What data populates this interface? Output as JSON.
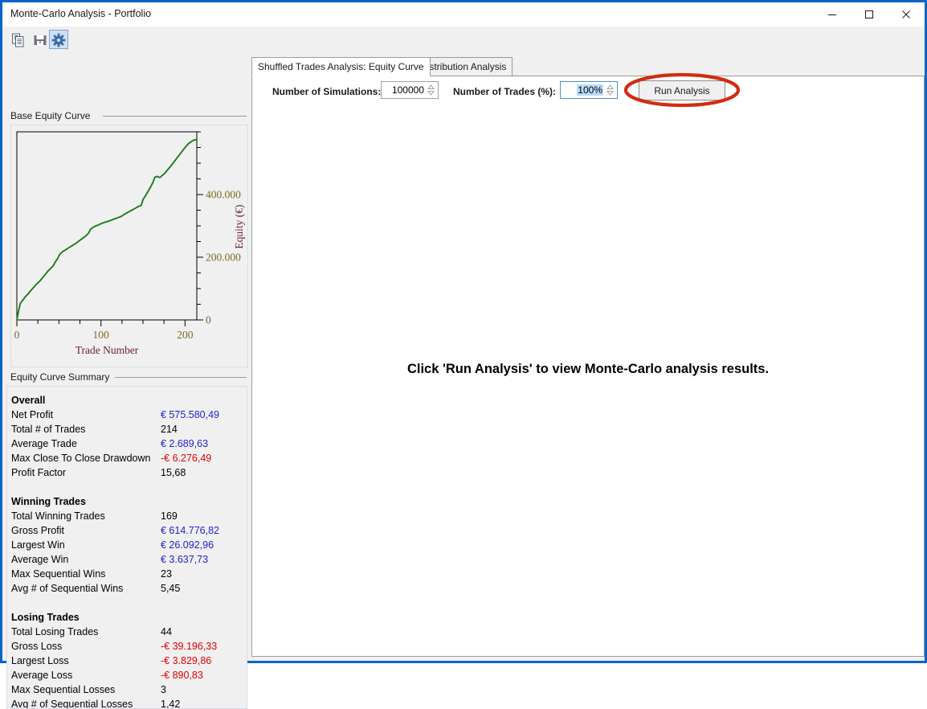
{
  "window": {
    "title": "Monte-Carlo Analysis - Portfolio",
    "minimize_label": "Minimize",
    "maximize_label": "Maximize",
    "close_label": "Close",
    "accent_color": "#0a64c8"
  },
  "toolbar": {
    "buttons": [
      {
        "name": "copy-icon",
        "label": "Copy"
      },
      {
        "name": "save-icon",
        "label": "Save"
      },
      {
        "name": "settings-gear-icon",
        "label": "Settings",
        "selected": true
      }
    ]
  },
  "left_pane": {
    "chart_group_title": "Base Equity Curve",
    "summary_group_title": "Equity Curve Summary",
    "summary": {
      "sections": [
        {
          "title": "Overall",
          "rows": [
            {
              "label": "Net Profit",
              "value": "€ 575.580,49",
              "tone": "pos"
            },
            {
              "label": "Total # of Trades",
              "value": "214",
              "tone": "neutral"
            },
            {
              "label": "Average Trade",
              "value": "€ 2.689,63",
              "tone": "pos"
            },
            {
              "label": "Max Close To Close Drawdown",
              "value": "-€ 6.276,49",
              "tone": "neg"
            },
            {
              "label": "Profit Factor",
              "value": "15,68",
              "tone": "neutral"
            }
          ]
        },
        {
          "title": "Winning Trades",
          "rows": [
            {
              "label": "Total Winning Trades",
              "value": "169",
              "tone": "neutral"
            },
            {
              "label": "Gross Profit",
              "value": "€ 614.776,82",
              "tone": "pos"
            },
            {
              "label": "Largest Win",
              "value": "€ 26.092,96",
              "tone": "pos"
            },
            {
              "label": "Average Win",
              "value": "€ 3.637,73",
              "tone": "pos"
            },
            {
              "label": "Max Sequential Wins",
              "value": "23",
              "tone": "neutral"
            },
            {
              "label": "Avg # of Sequential Wins",
              "value": "5,45",
              "tone": "neutral"
            }
          ]
        },
        {
          "title": "Losing Trades",
          "rows": [
            {
              "label": "Total Losing Trades",
              "value": "44",
              "tone": "neutral"
            },
            {
              "label": "Gross Loss",
              "value": "-€ 39.196,33",
              "tone": "neg"
            },
            {
              "label": "Largest Loss",
              "value": "-€ 3.829,86",
              "tone": "neg"
            },
            {
              "label": "Average Loss",
              "value": "-€ 890,83",
              "tone": "neg"
            },
            {
              "label": "Max Sequential Losses",
              "value": "3",
              "tone": "neutral"
            },
            {
              "label": "Avg # of Sequential Losses",
              "value": "1,42",
              "tone": "neutral"
            }
          ]
        }
      ]
    }
  },
  "tabs": [
    {
      "label": "Shuffled Trades Analysis: Equity Curve",
      "active": true
    },
    {
      "label": "Distribution Analysis",
      "active": false
    }
  ],
  "controls": {
    "simulations_label": "Number of Simulations:",
    "simulations_value": "100000",
    "trades_label": "Number of Trades (%):",
    "trades_value": "100%",
    "trades_value_selected": true,
    "run_button_label": "Run Analysis",
    "annotation_color": "#d42b10"
  },
  "main": {
    "placeholder_message": "Click 'Run Analysis' to view Monte-Carlo analysis results."
  },
  "chart_data": {
    "type": "line",
    "title": "Base Equity Curve",
    "xlabel": "Trade Number",
    "ylabel": "Equity (€)",
    "xlim": [
      0,
      214
    ],
    "ylim": [
      0,
      600000
    ],
    "xticks": [
      0,
      100,
      200
    ],
    "xticklabels": [
      "0",
      "100",
      "200"
    ],
    "yticks": [
      0,
      200000,
      400000
    ],
    "yticklabels": [
      "0",
      "200.000",
      "400.000"
    ],
    "y_minor_tick_step": 50000,
    "x_minor_tick_step": 25,
    "grid": false,
    "legend": false,
    "series": [
      {
        "name": "Equity",
        "color": "#1d7a1d",
        "x": [
          0,
          2,
          4,
          6,
          8,
          10,
          13,
          16,
          19,
          22,
          25,
          28,
          31,
          34,
          37,
          40,
          43,
          46,
          49,
          50,
          52,
          55,
          58,
          61,
          64,
          67,
          70,
          73,
          76,
          79,
          82,
          85,
          88,
          91,
          94,
          97,
          100,
          104,
          108,
          112,
          116,
          120,
          124,
          128,
          132,
          136,
          140,
          144,
          148,
          150,
          153,
          156,
          159,
          162,
          164,
          167,
          170,
          173,
          176,
          180,
          184,
          188,
          192,
          196,
          200,
          204,
          208,
          211,
          214
        ],
        "y": [
          0,
          28000,
          52000,
          60000,
          66000,
          74000,
          82000,
          92000,
          101000,
          110000,
          118000,
          126000,
          136000,
          146000,
          156000,
          164000,
          172000,
          186000,
          198000,
          205000,
          212000,
          219000,
          224000,
          229000,
          234000,
          239000,
          244000,
          250000,
          256000,
          262000,
          268000,
          276000,
          290000,
          296000,
          300000,
          303000,
          307000,
          311000,
          314000,
          318000,
          322000,
          326000,
          330000,
          337000,
          343000,
          349000,
          355000,
          361000,
          366000,
          384000,
          396000,
          410000,
          424000,
          440000,
          455000,
          458000,
          454000,
          461000,
          468000,
          481000,
          494000,
          508000,
          522000,
          536000,
          550000,
          562000,
          570000,
          574000,
          575580
        ]
      }
    ]
  }
}
